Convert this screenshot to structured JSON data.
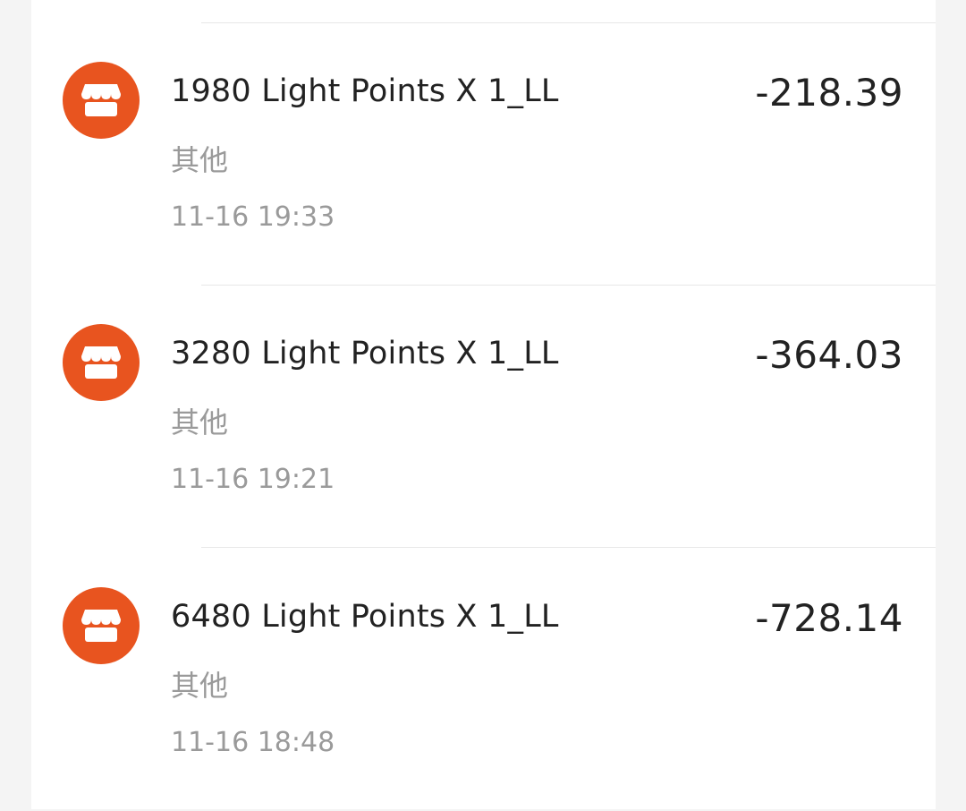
{
  "transactions": [
    {
      "title": "1980 Light Points X 1_LL",
      "category": "其他",
      "time": "11-16 19:33",
      "amount": "-218.39",
      "icon": "store-icon"
    },
    {
      "title": "3280 Light Points X 1_LL",
      "category": "其他",
      "time": "11-16 19:21",
      "amount": "-364.03",
      "icon": "store-icon"
    },
    {
      "title": "6480 Light Points X 1_LL",
      "category": "其他",
      "time": "11-16 18:48",
      "amount": "-728.14",
      "icon": "store-icon"
    }
  ],
  "colors": {
    "icon_background": "#e8541f",
    "background": "#f4f4f4",
    "card": "#ffffff"
  }
}
